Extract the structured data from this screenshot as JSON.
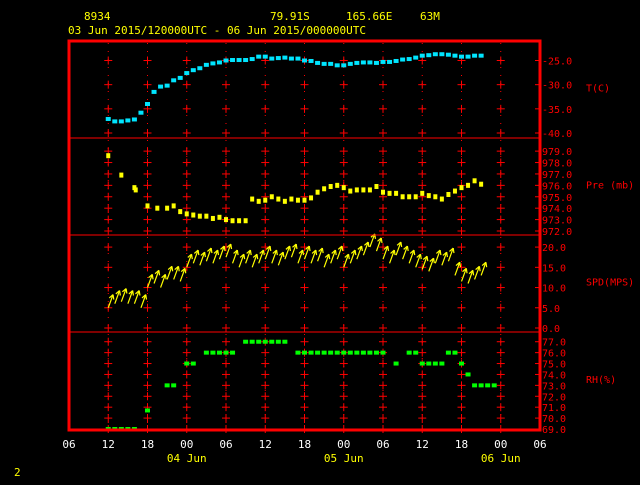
{
  "header": {
    "station_id": "8934",
    "lat": "79.91S",
    "lon": "165.66E",
    "elev": "63M",
    "time_range": "03 Jun 2015/120000UTC - 06 Jun 2015/000000UTC"
  },
  "page_number": "2",
  "colors": {
    "background": "#000000",
    "frame": "#ff0000",
    "ticks": "#ff0000",
    "labels": "#ff0000",
    "header_text": "#ffff00",
    "temperature": "#00e5ff",
    "pressure": "#ffff00",
    "wind": "#ffff00",
    "rh": "#00ff00"
  },
  "chart_data": {
    "type": "scatter",
    "x_axis": {
      "unit": "hours from 03 Jun 06 UTC",
      "range": [
        0,
        72
      ],
      "tick_labels": [
        "06",
        "12",
        "18",
        "00",
        "06",
        "12",
        "18",
        "00",
        "06",
        "12",
        "18",
        "00",
        "06"
      ],
      "tick_hours": [
        0,
        6,
        12,
        18,
        24,
        30,
        36,
        42,
        48,
        54,
        60,
        66,
        72
      ],
      "day_labels": [
        {
          "label": "04 Jun",
          "hour": 18
        },
        {
          "label": "05 Jun",
          "hour": 42
        },
        {
          "label": "06 Jun",
          "hour": 66
        }
      ]
    },
    "panels": [
      {
        "name": "temperature",
        "label": "T(C)",
        "ylim": [
          -40,
          -22
        ],
        "tick_values": [
          -40,
          -35,
          -30,
          -25
        ],
        "tick_labels": [
          "-40.0",
          "-35.0",
          "-30.0",
          "-25.0"
        ],
        "points": [
          [
            6,
            -37.1
          ],
          [
            7,
            -37.6
          ],
          [
            8,
            -37.6
          ],
          [
            9,
            -37.4
          ],
          [
            10,
            -37.2
          ],
          [
            11,
            -35.8
          ],
          [
            12,
            -34.0
          ],
          [
            13,
            -31.5
          ],
          [
            14,
            -30.4
          ],
          [
            15,
            -30.2
          ],
          [
            16,
            -29.1
          ],
          [
            17,
            -28.6
          ],
          [
            18,
            -27.6
          ],
          [
            19,
            -27.0
          ],
          [
            20,
            -26.6
          ],
          [
            21,
            -25.9
          ],
          [
            22,
            -25.6
          ],
          [
            23,
            -25.4
          ],
          [
            24,
            -25.0
          ],
          [
            25,
            -24.9
          ],
          [
            26,
            -24.9
          ],
          [
            27,
            -24.9
          ],
          [
            28,
            -24.7
          ],
          [
            29,
            -24.2
          ],
          [
            30,
            -24.2
          ],
          [
            31,
            -24.6
          ],
          [
            32,
            -24.5
          ],
          [
            33,
            -24.4
          ],
          [
            34,
            -24.6
          ],
          [
            35,
            -24.6
          ],
          [
            36,
            -25.0
          ],
          [
            37,
            -25.1
          ],
          [
            38,
            -25.5
          ],
          [
            39,
            -25.7
          ],
          [
            40,
            -25.7
          ],
          [
            41,
            -26.0
          ],
          [
            42,
            -26.0
          ],
          [
            43,
            -25.7
          ],
          [
            44,
            -25.5
          ],
          [
            45,
            -25.4
          ],
          [
            46,
            -25.4
          ],
          [
            47,
            -25.5
          ],
          [
            48,
            -25.3
          ],
          [
            49,
            -25.3
          ],
          [
            50,
            -25.1
          ],
          [
            51,
            -24.8
          ],
          [
            52,
            -24.7
          ],
          [
            53,
            -24.4
          ],
          [
            54,
            -24.0
          ],
          [
            55,
            -23.9
          ],
          [
            56,
            -23.7
          ],
          [
            57,
            -23.7
          ],
          [
            58,
            -23.8
          ],
          [
            59,
            -24.0
          ],
          [
            60,
            -24.2
          ],
          [
            61,
            -24.2
          ],
          [
            62,
            -24.0
          ],
          [
            63,
            -24.0
          ]
        ]
      },
      {
        "name": "pressure",
        "label": "Pre (mb)",
        "ylim": [
          972,
          979.8
        ],
        "tick_values": [
          972,
          973,
          974,
          975,
          976,
          977,
          978,
          979
        ],
        "tick_labels": [
          "972.0",
          "973.0",
          "974.0",
          "975.0",
          "976.0",
          "977.0",
          "978.0",
          "979.0"
        ],
        "points": [
          [
            6,
            978.6
          ],
          [
            8,
            976.9
          ],
          [
            10,
            975.8
          ],
          [
            10.2,
            975.6
          ],
          [
            12,
            974.2
          ],
          [
            13.5,
            974.0
          ],
          [
            15,
            974.0
          ],
          [
            16,
            974.2
          ],
          [
            17,
            973.7
          ],
          [
            18,
            973.5
          ],
          [
            19,
            973.4
          ],
          [
            20,
            973.3
          ],
          [
            21,
            973.3
          ],
          [
            22,
            973.1
          ],
          [
            23,
            973.2
          ],
          [
            24,
            973.0
          ],
          [
            25,
            972.9
          ],
          [
            26,
            972.9
          ],
          [
            27,
            972.9
          ],
          [
            28,
            974.8
          ],
          [
            29,
            974.6
          ],
          [
            30,
            974.7
          ],
          [
            31,
            975.0
          ],
          [
            32,
            974.8
          ],
          [
            33,
            974.6
          ],
          [
            34,
            974.8
          ],
          [
            35,
            974.7
          ],
          [
            36,
            974.7
          ],
          [
            37,
            974.9
          ],
          [
            38,
            975.4
          ],
          [
            39,
            975.7
          ],
          [
            40,
            975.9
          ],
          [
            41,
            976.0
          ],
          [
            42,
            975.8
          ],
          [
            43,
            975.5
          ],
          [
            44,
            975.6
          ],
          [
            45,
            975.6
          ],
          [
            46,
            975.6
          ],
          [
            47,
            975.9
          ],
          [
            48,
            975.4
          ],
          [
            49,
            975.3
          ],
          [
            50,
            975.3
          ],
          [
            51,
            975.0
          ],
          [
            52,
            975.0
          ],
          [
            53,
            975.0
          ],
          [
            54,
            975.3
          ],
          [
            55,
            975.1
          ],
          [
            56,
            975.0
          ],
          [
            57,
            974.8
          ],
          [
            58,
            975.2
          ],
          [
            59,
            975.5
          ],
          [
            60,
            975.8
          ],
          [
            61,
            976.0
          ],
          [
            62,
            976.4
          ],
          [
            63,
            976.1
          ]
        ]
      },
      {
        "name": "wind",
        "label": "SPD(MPS)",
        "ylim": [
          0,
          22
        ],
        "tick_values": [
          0,
          5,
          10,
          15,
          20
        ],
        "tick_labels": [
          "0.0",
          "5.0",
          "10.0",
          "15.0",
          "20.0"
        ],
        "points": [
          [
            6,
            5
          ],
          [
            7,
            6
          ],
          [
            8,
            6.5
          ],
          [
            9,
            6
          ],
          [
            10,
            6
          ],
          [
            11,
            5
          ],
          [
            12,
            10
          ],
          [
            13,
            11
          ],
          [
            14,
            10
          ],
          [
            15,
            12
          ],
          [
            16,
            12
          ],
          [
            17,
            11.5
          ],
          [
            18,
            15
          ],
          [
            19,
            16
          ],
          [
            20,
            15.5
          ],
          [
            21,
            16.5
          ],
          [
            22,
            16
          ],
          [
            23,
            17
          ],
          [
            24,
            17.5
          ],
          [
            25,
            16
          ],
          [
            26,
            15
          ],
          [
            27,
            16
          ],
          [
            28,
            15
          ],
          [
            29,
            16
          ],
          [
            30,
            17
          ],
          [
            31,
            16
          ],
          [
            32,
            15.5
          ],
          [
            33,
            17
          ],
          [
            34,
            17.5
          ],
          [
            35,
            16
          ],
          [
            36,
            17
          ],
          [
            37,
            16
          ],
          [
            38,
            16.5
          ],
          [
            39,
            15
          ],
          [
            40,
            16
          ],
          [
            41,
            17
          ],
          [
            42,
            15
          ],
          [
            43,
            16
          ],
          [
            44,
            17
          ],
          [
            45,
            18
          ],
          [
            46,
            20
          ],
          [
            47,
            19
          ],
          [
            48,
            17
          ],
          [
            49,
            16
          ],
          [
            50,
            18
          ],
          [
            51,
            17
          ],
          [
            52,
            16
          ],
          [
            53,
            15
          ],
          [
            54,
            14.5
          ],
          [
            55,
            14
          ],
          [
            56,
            16
          ],
          [
            57,
            15.5
          ],
          [
            58,
            16.5
          ],
          [
            59,
            13
          ],
          [
            60,
            11.5
          ],
          [
            61,
            11
          ],
          [
            62,
            12
          ],
          [
            63,
            13
          ]
        ]
      },
      {
        "name": "rh",
        "label": "RH(%)",
        "ylim": [
          69,
          77.8
        ],
        "tick_values": [
          69,
          70,
          71,
          72,
          73,
          74,
          75,
          76,
          77
        ],
        "tick_labels": [
          "69.0",
          "70.0",
          "71.0",
          "72.0",
          "73.0",
          "74.0",
          "75.0",
          "76.0",
          "77.0"
        ],
        "points": [
          [
            6,
            69
          ],
          [
            7,
            69
          ],
          [
            8,
            69
          ],
          [
            9,
            69
          ],
          [
            10,
            69
          ],
          [
            12,
            70.7
          ],
          [
            15,
            73
          ],
          [
            16,
            73
          ],
          [
            18,
            75
          ],
          [
            19,
            75
          ],
          [
            21,
            76
          ],
          [
            22,
            76
          ],
          [
            23,
            76
          ],
          [
            24,
            76
          ],
          [
            25,
            76
          ],
          [
            27,
            77
          ],
          [
            28,
            77
          ],
          [
            29,
            77
          ],
          [
            30,
            77
          ],
          [
            31,
            77
          ],
          [
            32,
            77
          ],
          [
            33,
            77
          ],
          [
            35,
            76
          ],
          [
            36,
            76
          ],
          [
            37,
            76
          ],
          [
            38,
            76
          ],
          [
            39,
            76
          ],
          [
            40,
            76
          ],
          [
            41,
            76
          ],
          [
            42,
            76
          ],
          [
            43,
            76
          ],
          [
            44,
            76
          ],
          [
            45,
            76
          ],
          [
            46,
            76
          ],
          [
            47,
            76
          ],
          [
            48,
            76
          ],
          [
            50,
            75
          ],
          [
            52,
            76
          ],
          [
            53,
            76
          ],
          [
            54,
            75
          ],
          [
            55,
            75
          ],
          [
            56,
            75
          ],
          [
            57,
            75
          ],
          [
            58,
            76
          ],
          [
            59,
            76
          ],
          [
            60,
            75
          ],
          [
            61,
            74
          ],
          [
            62,
            73
          ],
          [
            63,
            73
          ],
          [
            64,
            73
          ],
          [
            65,
            73
          ]
        ]
      }
    ]
  }
}
